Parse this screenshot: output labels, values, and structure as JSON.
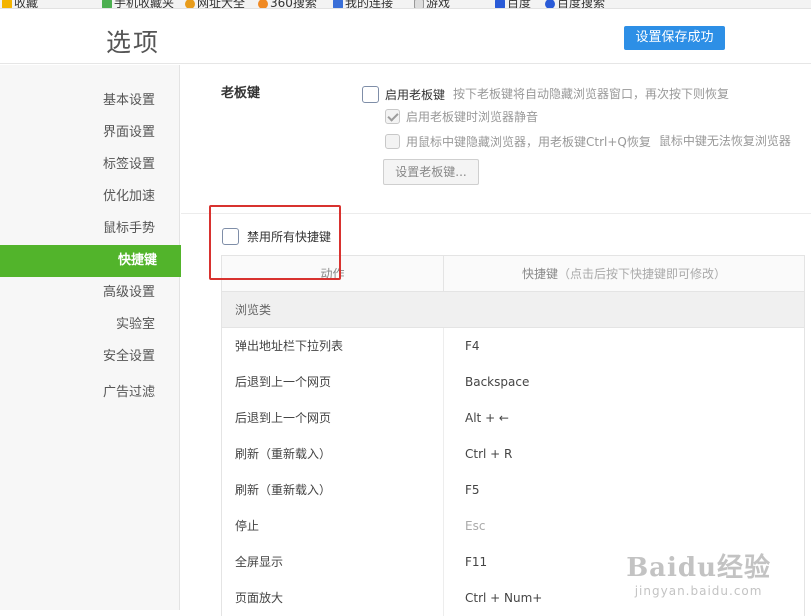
{
  "bookmarks": [
    {
      "label": "收藏",
      "icon": "star-icon"
    },
    {
      "label": "手机收藏夹",
      "icon": "phone-icon"
    },
    {
      "label": "网址大全",
      "icon": "globe-icon"
    },
    {
      "label": "360搜索",
      "icon": "search-icon"
    },
    {
      "label": "我的连接",
      "icon": "link-icon"
    },
    {
      "label": "游戏",
      "icon": "file-icon"
    },
    {
      "label": "百度",
      "icon": "paw-icon"
    },
    {
      "label": "百度搜索",
      "icon": "search-icon"
    }
  ],
  "header": {
    "title": "选项",
    "save_status": "设置保存成功",
    "accent": "#2d8fe6"
  },
  "sidebar": {
    "items": [
      {
        "label": "基本设置"
      },
      {
        "label": "界面设置"
      },
      {
        "label": "标签设置"
      },
      {
        "label": "优化加速"
      },
      {
        "label": "鼠标手势"
      },
      {
        "label": "快捷键"
      },
      {
        "label": "高级设置"
      },
      {
        "label": "实验室"
      },
      {
        "label": "安全设置"
      },
      {
        "label": "广告过滤"
      }
    ],
    "active_index": 5,
    "active_color": "#52b42b"
  },
  "boss_key": {
    "section_title": "老板键",
    "enable_label": "启用老板键",
    "enable_hint": "按下老板键将自动隐藏浏览器窗口，再次按下则恢复",
    "enable_checked": false,
    "mute_label": "启用老板键时浏览器静音",
    "mute_checked": true,
    "middle_click_label": "用鼠标中键隐藏浏览器，用老板键Ctrl+Q恢复",
    "middle_click_hint": "鼠标中键无法恢复浏览器",
    "middle_click_checked": false,
    "set_button": "设置老板键..."
  },
  "shortcuts": {
    "disable_all_label": "禁用所有快捷键",
    "disable_all_checked": false,
    "highlight_color": "#d8322f",
    "col_action": "动作",
    "col_key": "快捷键",
    "col_key_hint": "（点击后按下快捷键即可修改）",
    "group_label": "浏览类",
    "rows": [
      {
        "action": "弹出地址栏下拉列表",
        "key": "F4"
      },
      {
        "action": "后退到上一个网页",
        "key": "Backspace"
      },
      {
        "action": "后退到上一个网页",
        "key": "Alt + ←"
      },
      {
        "action": "刷新（重新载入）",
        "key": "Ctrl + R"
      },
      {
        "action": "刷新（重新载入）",
        "key": "F5"
      },
      {
        "action": "停止",
        "key": "Esc"
      },
      {
        "action": "全屏显示",
        "key": "F11"
      },
      {
        "action": "页面放大",
        "key": "Ctrl + Num+"
      }
    ]
  },
  "watermark": {
    "main": "Baidu经验",
    "sub": "jingyan.baidu.com"
  }
}
